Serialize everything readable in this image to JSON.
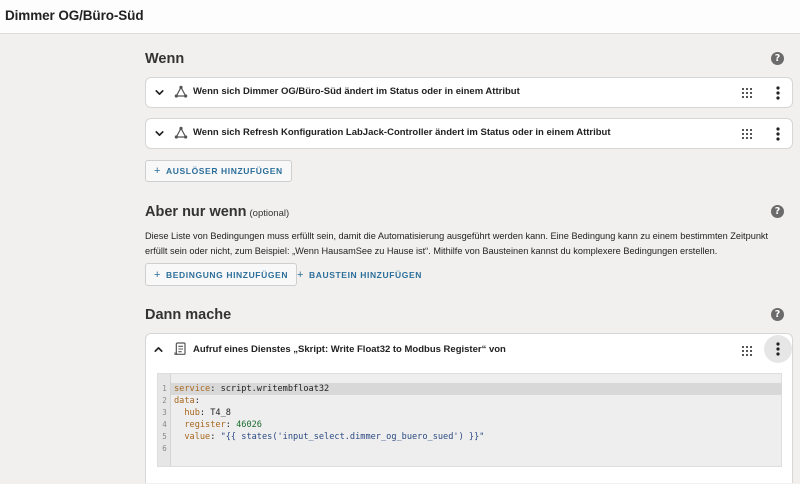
{
  "header": {
    "title": "Dimmer OG/Büro-Süd"
  },
  "help_glyph": "?",
  "triggers_section": {
    "title": "Wenn",
    "items": [
      {
        "label": "Wenn sich Dimmer OG/Büro-Süd ändert im Status oder in einem Attribut",
        "icon": "state-trigger-icon"
      },
      {
        "label": "Wenn sich Refresh Konfiguration LabJack-Controller ändert im Status oder in einem Attribut",
        "icon": "state-trigger-icon"
      }
    ],
    "add_button": "AUSLÖSER HINZUFÜGEN"
  },
  "conditions_section": {
    "title": "Aber nur wenn",
    "optional": "(optional)",
    "description": "Diese Liste von Bedingungen muss erfüllt sein, damit die Automatisierung ausgeführt werden kann. Eine Bedingung kann zu einem bestimmten Zeitpunkt erfüllt sein oder nicht, zum Beispiel: „Wenn HausamSee zu Hause ist“. Mithilfe von Bausteinen kannst du komplexere Bedingungen erstellen.",
    "add_condition_button": "BEDINGUNG HINZUFÜGEN",
    "add_block_button": "BAUSTEIN HINZUFÜGEN"
  },
  "actions_section": {
    "title": "Dann mache",
    "action": {
      "label": "Aufruf eines Dienstes „Skript: Write Float32 to Modbus Register“ von",
      "icon": "service-call-icon"
    },
    "code": {
      "lines": [
        {
          "n": "1",
          "key": "service",
          "sep": ": ",
          "val": "script.writembfloat32"
        },
        {
          "n": "2",
          "key": "data",
          "sep": ":",
          "val": ""
        },
        {
          "n": "3",
          "key": "  hub",
          "sep": ": ",
          "val": "T4_8"
        },
        {
          "n": "4",
          "key": "  register",
          "sep": ": ",
          "val": "46026"
        },
        {
          "n": "5",
          "key": "  value",
          "sep": ": ",
          "val": "\"{{ states('input_select.dimmer_og_buero_sued') }}\""
        },
        {
          "n": "6",
          "key": "",
          "sep": "",
          "val": ""
        }
      ]
    }
  },
  "colors": {
    "accent": "#2c6f9b",
    "yaml_key": "#a8671e",
    "yaml_string": "#2b4a83",
    "yaml_number": "#1b6d2e"
  }
}
